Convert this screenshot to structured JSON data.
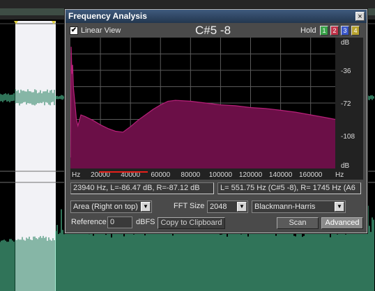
{
  "window": {
    "title": "Frequency Analysis",
    "close_glyph": "×"
  },
  "linear_view": {
    "checked": true,
    "check_glyph": "✔",
    "label": "Linear View"
  },
  "note_display": "C#5 -8",
  "hold": {
    "label": "Hold",
    "buttons": [
      {
        "label": "1",
        "color": "#3aa34a"
      },
      {
        "label": "2",
        "color": "#c0344a"
      },
      {
        "label": "3",
        "color": "#3b57c8"
      },
      {
        "label": "4",
        "color": "#b8a22e"
      }
    ]
  },
  "chart_data": {
    "type": "area",
    "xlabel": "Hz",
    "ylabel": "dB",
    "x_ticks": [
      "20000",
      "40000",
      "60000",
      "80000",
      "100000",
      "120000",
      "140000",
      "160000"
    ],
    "x_range": [
      0,
      176400
    ],
    "y_ticks": [
      "-36",
      "-72",
      "-108"
    ],
    "y_range": [
      0,
      -144
    ],
    "grid": true,
    "fill_color": "#6b0f47",
    "line_color": "#b8207a",
    "x": [
      0,
      500,
      1000,
      1500,
      2000,
      3000,
      4000,
      5000,
      7000,
      10000,
      15000,
      20000,
      25000,
      30000,
      35000,
      40000,
      45000,
      50000,
      55000,
      60000,
      65000,
      70000,
      80000,
      90000,
      100000,
      110000,
      120000,
      130000,
      140000,
      150000,
      160000,
      170000,
      176400
    ],
    "y": [
      -132,
      -10,
      -40,
      -30,
      -55,
      -72,
      -90,
      -97,
      -85,
      -87,
      -91,
      -96,
      -100,
      -103,
      -104,
      -98,
      -91,
      -85,
      -79,
      -74,
      -70,
      -69,
      -70,
      -72,
      -74,
      -75,
      -77,
      -78,
      -80,
      -82,
      -85,
      -88,
      -90
    ]
  },
  "readouts": {
    "cursor": "23940 Hz, L=-86.47 dB, R=-87.12 dB",
    "peak": "L= 551.75 Hz (C#5 -8), R= 1745 Hz (A6"
  },
  "controls": {
    "graph_mode": "Area (Right on top)",
    "fft_size_label": "FFT Size",
    "fft_size": "2048",
    "window_func": "Blackmann-Harris",
    "reference_label": "Reference",
    "reference_value": "0",
    "reference_unit": "dBFS",
    "copy_button": "Copy to Clipboard",
    "scan_button": "Scan",
    "advanced_button": "Advanced",
    "dropdown_glyph": "▼"
  }
}
